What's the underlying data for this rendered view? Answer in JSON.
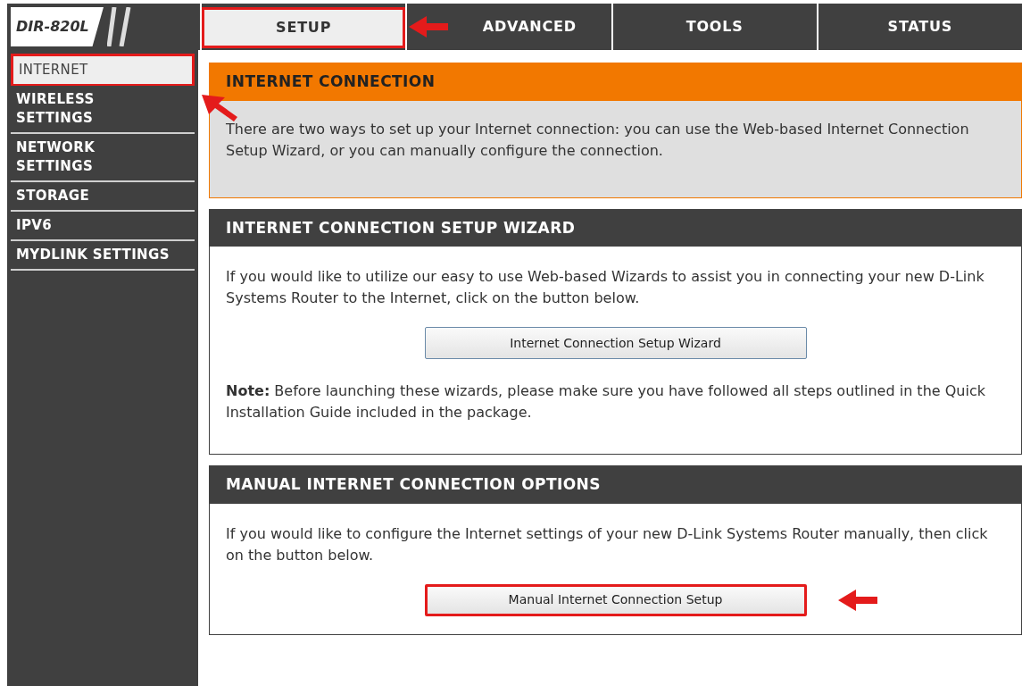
{
  "logo": {
    "model": "DIR-820L"
  },
  "tabs": [
    {
      "label": "SETUP",
      "selected": true,
      "highlighted": true
    },
    {
      "label": "ADVANCED",
      "selected": false,
      "highlighted": false
    },
    {
      "label": "TOOLS",
      "selected": false,
      "highlighted": false
    },
    {
      "label": "STATUS",
      "selected": false,
      "highlighted": false
    }
  ],
  "sidebar": {
    "items": [
      {
        "label": "INTERNET",
        "selected": true,
        "highlighted": true
      },
      {
        "label": "WIRELESS\nSETTINGS",
        "selected": false,
        "highlighted": false
      },
      {
        "label": "NETWORK\nSETTINGS",
        "selected": false,
        "highlighted": false
      },
      {
        "label": "STORAGE",
        "selected": false,
        "highlighted": false
      },
      {
        "label": "IPV6",
        "selected": false,
        "highlighted": false
      },
      {
        "label": "MYDLINK SETTINGS",
        "selected": false,
        "highlighted": false
      }
    ]
  },
  "sections": [
    {
      "kind": "intro",
      "title": "INTERNET CONNECTION",
      "paragraphs": [
        "There are two ways to set up your Internet connection: you can use the Web-based Internet Connection Setup Wizard, or you can manually configure the connection."
      ]
    },
    {
      "kind": "panel",
      "title": "INTERNET CONNECTION SETUP WIZARD",
      "paragraphs": [
        "If you would like to utilize our easy to use Web-based Wizards to assist you in connecting your new D-Link Systems Router to the Internet, click on the button below."
      ],
      "button": {
        "label": "Internet Connection Setup Wizard",
        "highlighted": false
      },
      "note": "**Note:** Before launching these wizards, please make sure you have followed all steps outlined in the Quick Installation Guide included in the package."
    },
    {
      "kind": "panel",
      "title": "MANUAL INTERNET CONNECTION OPTIONS",
      "paragraphs": [
        "If you would like to configure the Internet settings of your new D-Link Systems Router manually, then click on the button below."
      ],
      "button": {
        "label": "Manual Internet Connection Setup",
        "highlighted": true
      }
    }
  ]
}
